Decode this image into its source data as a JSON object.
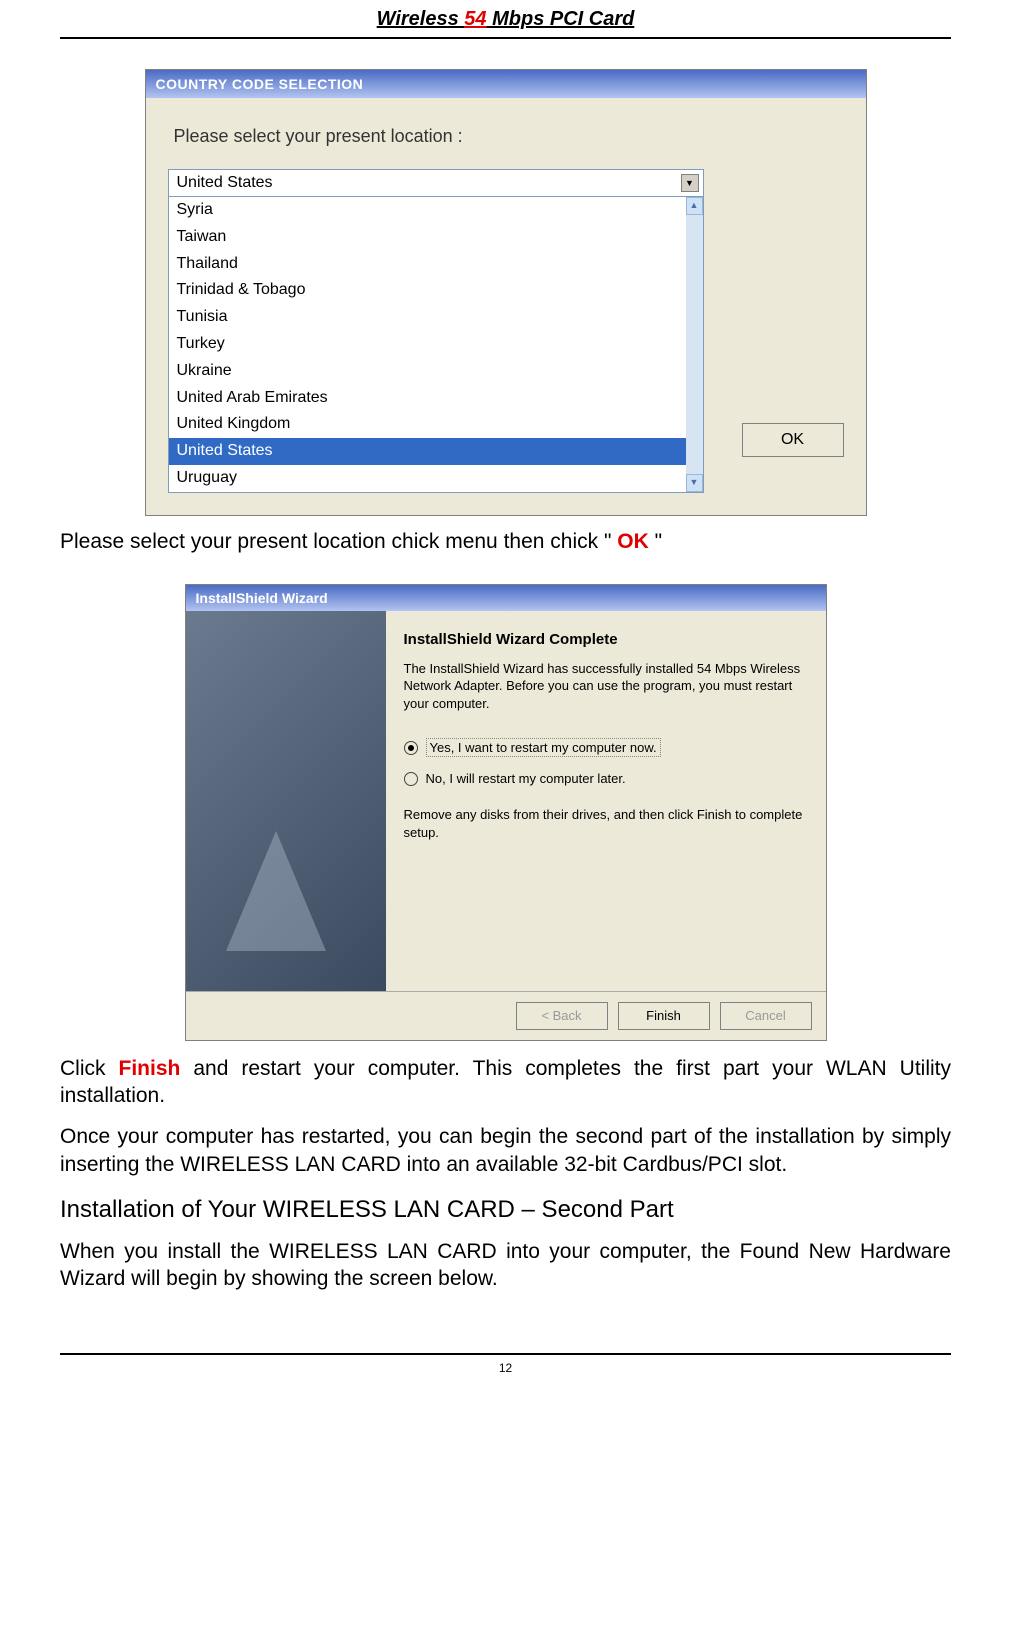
{
  "header": {
    "pre": "Wireless ",
    "red": "54",
    "post": " Mbps PCI Card"
  },
  "dialog1": {
    "title": "COUNTRY CODE SELECTION",
    "instruction": "Please select your present location :",
    "selected_display": "United States",
    "items": [
      {
        "label": "Syria",
        "selected": false
      },
      {
        "label": "Taiwan",
        "selected": false
      },
      {
        "label": "Thailand",
        "selected": false
      },
      {
        "label": "Trinidad & Tobago",
        "selected": false
      },
      {
        "label": "Tunisia",
        "selected": false
      },
      {
        "label": "Turkey",
        "selected": false
      },
      {
        "label": "Ukraine",
        "selected": false
      },
      {
        "label": "United Arab Emirates",
        "selected": false
      },
      {
        "label": "United Kingdom",
        "selected": false
      },
      {
        "label": "United States",
        "selected": true
      },
      {
        "label": "Uruguay",
        "selected": false
      }
    ],
    "ok_label": "OK"
  },
  "caption1": {
    "pre": "Please select your present location chick menu then chick  \" ",
    "red": "OK",
    "post": " \""
  },
  "dialog2": {
    "title": "InstallShield Wizard",
    "heading": "InstallShield Wizard Complete",
    "paragraph": "The InstallShield Wizard has successfully installed 54 Mbps Wireless Network Adapter.  Before you can use the program, you must restart your computer.",
    "radio_yes": "Yes, I want to restart my computer now.",
    "radio_no": "No, I will restart my computer later.",
    "footer_para": "Remove any disks from their drives, and then click Finish to complete setup.",
    "btn_back": "< Back",
    "btn_finish": "Finish",
    "btn_cancel": "Cancel"
  },
  "body": {
    "p1_pre": "Click ",
    "p1_red": "Finish",
    "p1_post": " and restart your computer. This completes the first part your WLAN Utility installation.",
    "p2": "Once your computer has restarted, you can begin the second part of the installation by simply inserting the WIRELESS LAN CARD into an available 32-bit Cardbus/PCI slot.",
    "h": "Installation of Your WIRELESS LAN CARD – Second Part",
    "p3": "When you install the WIRELESS LAN CARD into your computer, the Found New Hardware Wizard will begin by showing the screen below."
  },
  "pagenum": "12"
}
